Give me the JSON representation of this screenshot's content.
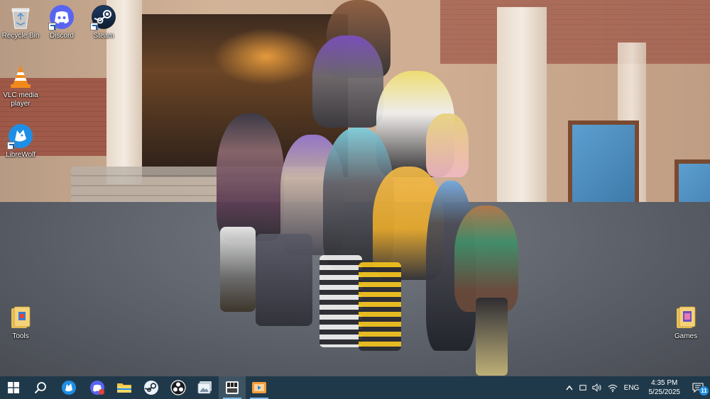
{
  "desktop": {
    "icons": [
      {
        "label": "Recycle Bin",
        "icon": "recycle-bin-icon"
      },
      {
        "label": "Discord",
        "icon": "discord-icon",
        "color": "#5865f2"
      },
      {
        "label": "Steam",
        "icon": "steam-icon",
        "color": "#1b2838"
      },
      {
        "label": "VLC media player",
        "icon": "vlc-icon",
        "color": "#f28a1b"
      },
      {
        "label": "LibreWolf",
        "icon": "librewolf-icon",
        "color": "#1f8fe5"
      },
      {
        "label": "Tools",
        "icon": "folder-icon",
        "color": "#e8c15a"
      },
      {
        "label": "Games",
        "icon": "folder-icon",
        "color": "#e8c15a"
      }
    ]
  },
  "taskbar": {
    "background": "#20394a",
    "apps": [
      {
        "name": "start",
        "icon": "windows-icon"
      },
      {
        "name": "search",
        "icon": "search-icon"
      },
      {
        "name": "librewolf",
        "icon": "librewolf-icon"
      },
      {
        "name": "discord",
        "icon": "discord-icon"
      },
      {
        "name": "file-explorer",
        "icon": "folder-icon"
      },
      {
        "name": "steam",
        "icon": "steam-icon"
      },
      {
        "name": "obs",
        "icon": "obs-icon"
      },
      {
        "name": "photos",
        "icon": "photos-icon"
      },
      {
        "name": "app-active",
        "icon": "media-app-icon"
      },
      {
        "name": "vlc-video",
        "icon": "video-player-icon"
      }
    ],
    "tray": {
      "language": "ENG",
      "time": "4:35 PM",
      "date": "5/25/2025",
      "notification_count": "11"
    }
  }
}
